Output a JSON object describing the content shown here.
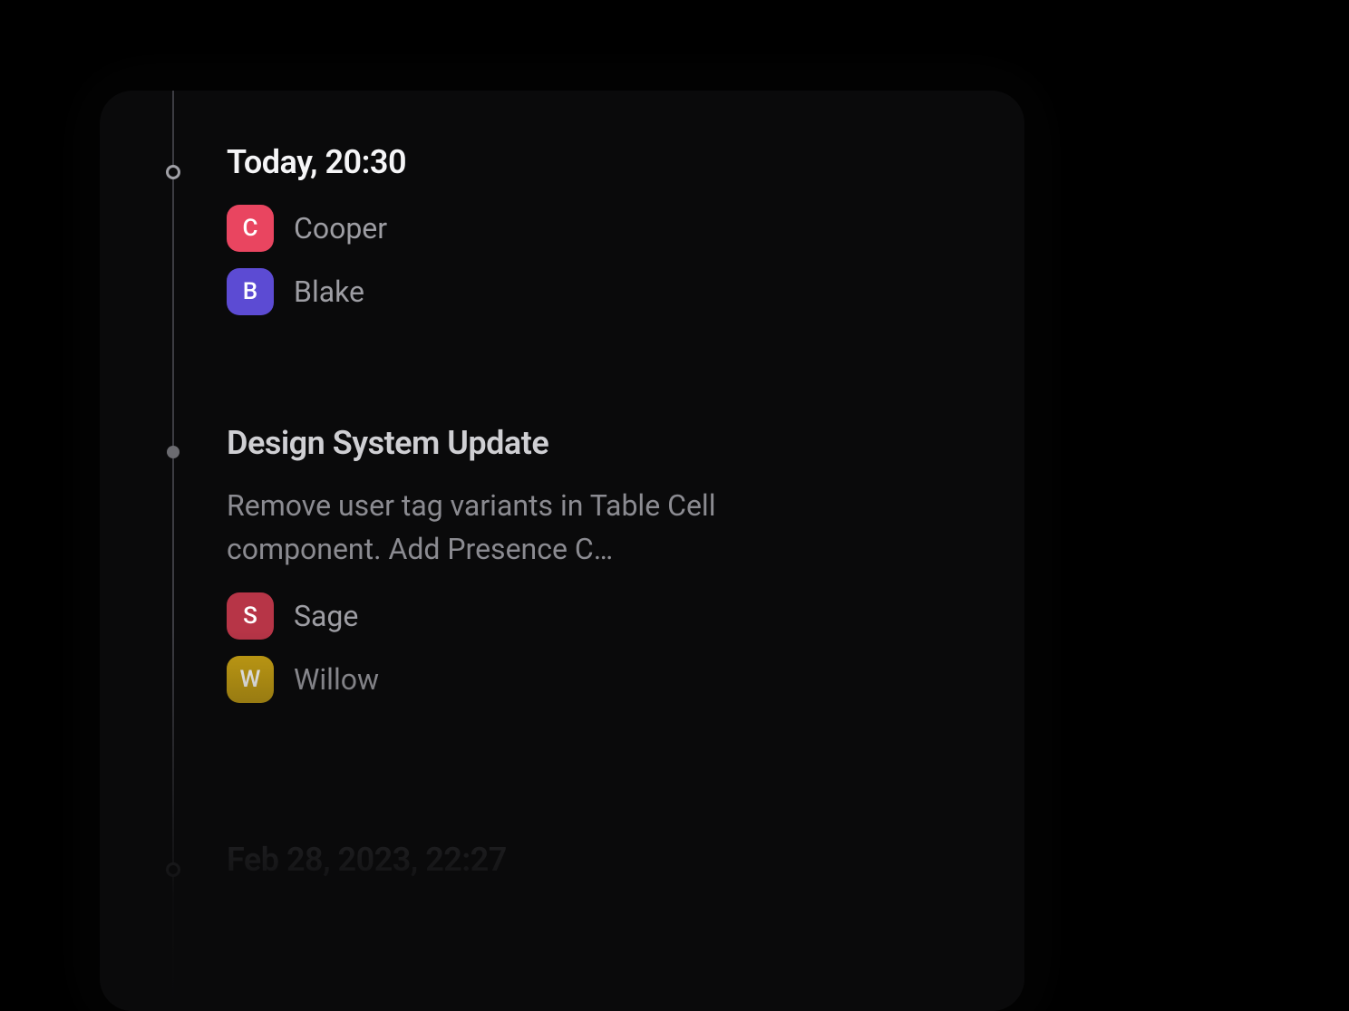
{
  "entries": [
    {
      "timestamp": "Today, 20:30",
      "timestamp_style": "bright",
      "dot_style": "ring",
      "users": [
        {
          "initial": "C",
          "name": "Cooper",
          "color": "#e94560"
        },
        {
          "initial": "B",
          "name": "Blake",
          "color": "#5c4bd3"
        }
      ]
    },
    {
      "title": "Design System Update",
      "body": "Remove user tag variants in Table Cell component. Add Presence C…",
      "dot_style": "fill",
      "users": [
        {
          "initial": "S",
          "name": "Sage",
          "color": "#b73547"
        },
        {
          "initial": "W",
          "name": "Willow",
          "color": "#c9a214"
        }
      ]
    },
    {
      "timestamp": "Feb 28, 2023, 22:27",
      "timestamp_style": "dim",
      "dot_style": "ring"
    }
  ]
}
